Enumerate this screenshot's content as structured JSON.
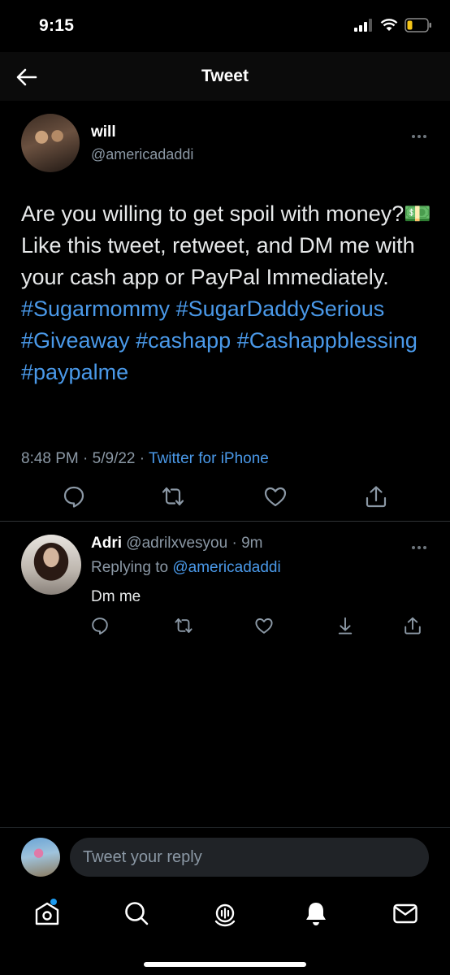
{
  "status_bar": {
    "time": "9:15"
  },
  "nav": {
    "title": "Tweet"
  },
  "tweet": {
    "author_name": "will",
    "author_handle": "@americadaddi",
    "text_plain_1": "Are you willing to get spoil with money?💵 Like this tweet, retweet, and DM me with your cash app or PayPal Immediately. ",
    "hashtags": [
      "#Sugarmommy",
      "#SugarDaddySerious",
      "#Giveaway",
      "#cashapp",
      "#Cashappblessing",
      "#paypalme"
    ],
    "time": "8:48 PM",
    "date": "5/9/22",
    "source": "Twitter for iPhone"
  },
  "reply": {
    "name": "Adri",
    "handle": "@adrilxvesyou",
    "age": "9m",
    "replying_prefix": "Replying to",
    "replying_to": "@americadaddi",
    "text": "Dm me"
  },
  "composer": {
    "placeholder": "Tweet your reply"
  },
  "colors": {
    "accent": "#4a99e9",
    "muted": "#8b98a5",
    "background": "#000000"
  },
  "icons": {
    "nav": [
      "arrow-left-icon"
    ],
    "tweet_actions": [
      "reply-icon",
      "retweet-icon",
      "like-icon",
      "share-icon"
    ],
    "reply_actions": [
      "reply-icon",
      "retweet-icon",
      "like-icon",
      "download-icon",
      "share-icon"
    ],
    "tabs": [
      "home-icon",
      "search-icon",
      "spaces-icon",
      "notifications-icon",
      "messages-icon"
    ]
  }
}
